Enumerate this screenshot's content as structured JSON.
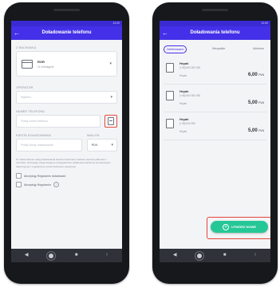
{
  "colors": {
    "primary": "#4330e8",
    "accent": "#26c797",
    "highlight": "#e4453a"
  },
  "left_screen": {
    "status_time": "12:00",
    "appbar": {
      "back_icon": "arrow-left-icon",
      "title": "Doładowanie telefonu"
    },
    "account_section_label": "Z RACHUNKU",
    "account": {
      "name": "ROR",
      "sub": "11 zł dostępne"
    },
    "operator_label": "OPERATOR",
    "operator_placeholder": "Wybierz",
    "phone_label": "NUMER TELEFONU",
    "phone_placeholder": "Podaj numer telefonu",
    "amount_label": "KWOTA DOŁADOWANIA",
    "amount_placeholder": "Podaj kwotę doładowania",
    "currency_label": "WALUTA",
    "currency_value": "PLN",
    "disclaimer": "Po zatwierdzeniu usługi doładowania telefonu dokonane zostanie zlecenie płatności z rachunku. Szczegóły usługi dostępne w Regulaminie doładowań telefonów komórkowych. Zapoznaj się z regulaminem przed złożeniem dyspozycji.",
    "consents": [
      {
        "label": "Akceptuję Regulamin doładowań"
      },
      {
        "label": "Akceptuję Regulamin"
      }
    ]
  },
  "right_screen": {
    "status_time": "12:00",
    "appbar": {
      "back_icon": "arrow-left-icon",
      "title": "Doładowania telefonu"
    },
    "tabs": [
      {
        "label": "Zdefiniowane",
        "active": true
      },
      {
        "label": "Wszystkie"
      },
      {
        "label": "Ulubione"
      }
    ],
    "items": [
      {
        "title": "Heyah",
        "number": "(+48) 600 000 000",
        "status": "Heyah",
        "amount": "6,00",
        "currency": "PLN"
      },
      {
        "title": "Heyah",
        "number": "(+48) 500 000 000",
        "status": "Heyah",
        "amount": "5,00",
        "currency": "PLN"
      },
      {
        "title": "Heyah",
        "number": "(+48) 510 000",
        "status": "Heyah",
        "amount": "5,00",
        "currency": "PLN"
      }
    ],
    "fab_label": "UTWÓRZ NOWE"
  },
  "navbar": {
    "back": "◀",
    "recent": "■",
    "menu": "↑"
  }
}
